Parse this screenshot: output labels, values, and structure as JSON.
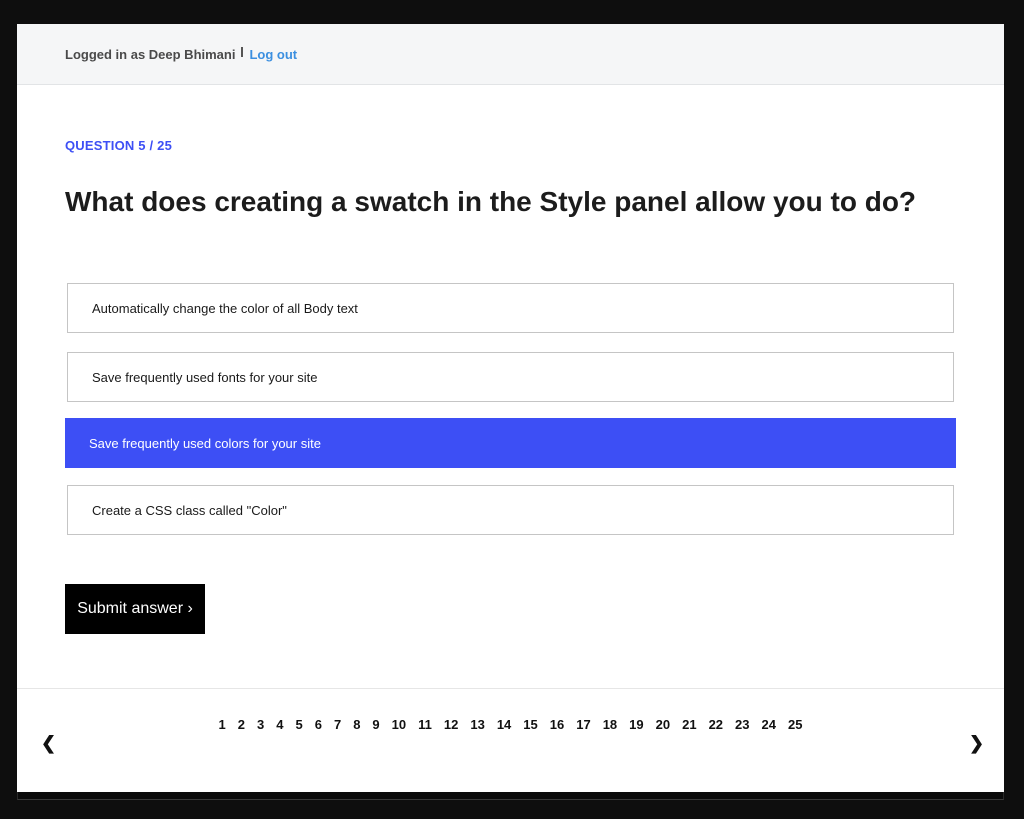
{
  "header": {
    "logged_in_text": "Logged in as Deep Bhimani",
    "logout_label": "Log out"
  },
  "quiz": {
    "counter": "QUESTION 5 / 25",
    "question": "What does creating a swatch in the Style panel allow you to do?",
    "options": [
      {
        "label": "Automatically change the color of all Body text",
        "selected": false
      },
      {
        "label": "Save frequently used fonts for your site",
        "selected": false
      },
      {
        "label": "Save frequently used colors for your site",
        "selected": true
      },
      {
        "label": "Create a CSS class called \"Color\"",
        "selected": false
      }
    ],
    "submit_label": "Submit answer ›"
  },
  "pagination": {
    "prev": "❮",
    "next": "❯",
    "pages": [
      "1",
      "2",
      "3",
      "4",
      "5",
      "6",
      "7",
      "8",
      "9",
      "10",
      "11",
      "12",
      "13",
      "14",
      "15",
      "16",
      "17",
      "18",
      "19",
      "20",
      "21",
      "22",
      "23",
      "24",
      "25"
    ]
  },
  "colors": {
    "accent": "#3d4ff5",
    "link": "#3b8fe0",
    "submit_bg": "#000000"
  }
}
